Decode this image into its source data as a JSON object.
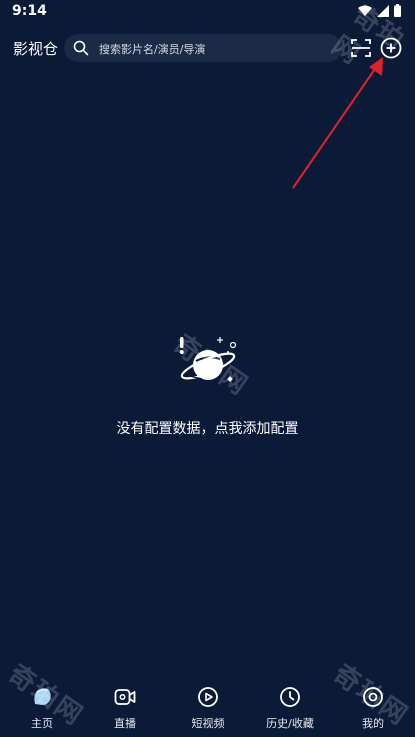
{
  "status_bar": {
    "time": "9:14"
  },
  "header": {
    "app_title": "影视仓",
    "search_placeholder": "搜索影片名/演员/导演"
  },
  "empty_state": {
    "message": "没有配置数据，点我添加配置"
  },
  "bottom_nav": [
    {
      "label": "主页",
      "icon": "home-icon",
      "active": true
    },
    {
      "label": "直播",
      "icon": "live-camera-icon"
    },
    {
      "label": "短视频",
      "icon": "play-circle-icon"
    },
    {
      "label": "历史/收藏",
      "icon": "clock-icon"
    },
    {
      "label": "我的",
      "icon": "profile-icon"
    }
  ],
  "watermark": {
    "text": "奇珀网"
  },
  "colors": {
    "background": "#0b1a36",
    "search_background": "#1b2a47",
    "annotation_arrow": "#e2222a",
    "home_icon": "#a9d4f5"
  }
}
